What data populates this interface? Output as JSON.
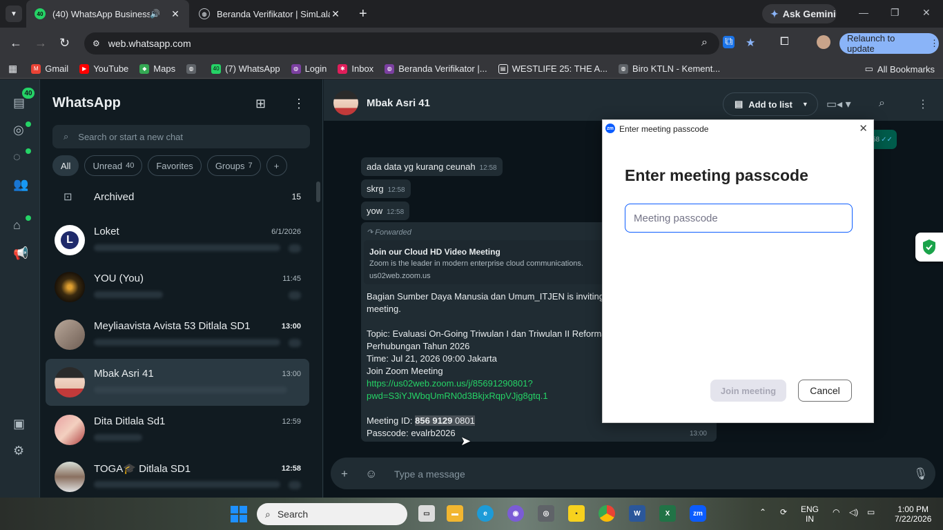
{
  "browser": {
    "tabs": [
      {
        "title": "(40) WhatsApp Business",
        "badge": "40"
      },
      {
        "title": "Beranda Verifikator | SimLala"
      }
    ],
    "gemini_label": "Ask Gemini",
    "url": "web.whatsapp.com",
    "relaunch_label": "Relaunch to update",
    "bookmarks": [
      "Gmail",
      "YouTube",
      "Maps",
      "(7) WhatsApp",
      "Login",
      "Inbox",
      "Beranda Verifikator |...",
      "WESTLIFE 25: THE A...",
      "Biro KTLN - Kement..."
    ],
    "bookmark_badge": "40",
    "all_bookmarks": "All Bookmarks",
    "accent": "#8ab4f8"
  },
  "whatsapp": {
    "rail_badge": "40",
    "title": "WhatsApp",
    "search_placeholder": "Search or start a new chat",
    "filters": [
      {
        "label": "All"
      },
      {
        "label": "Unread",
        "count": "40"
      },
      {
        "label": "Favorites"
      },
      {
        "label": "Groups",
        "count": "7"
      }
    ],
    "archived": {
      "label": "Archived",
      "count": "15"
    },
    "chats": [
      {
        "name": "Loket",
        "time": "6/1/2026"
      },
      {
        "name": "YOU (You)",
        "time": "11:45"
      },
      {
        "name": "Meyliaavista Avista 53 Ditlala SD1",
        "time": "13:00"
      },
      {
        "name": "Mbak Asri 41",
        "time": "13:00"
      },
      {
        "name": "Dita Ditlala Sd1",
        "time": "12:59"
      },
      {
        "name": "TOGA🎓 Ditlala SD1",
        "time": "12:58"
      }
    ],
    "brand_color": "#25d366"
  },
  "conversation": {
    "contact": "Mbak Asri 41",
    "add_to_list": "Add to list",
    "peek_time": "58",
    "messages": [
      {
        "text": "ada data yg kurang ceunah",
        "time": "12:58"
      },
      {
        "text": "skrg",
        "time": "12:58"
      },
      {
        "text": "yow",
        "time": "12:58"
      }
    ],
    "forwarded": {
      "label": "Forwarded",
      "preview_title": "Join our Cloud HD Video Meeting",
      "preview_desc": "Zoom is the leader in modern enterprise cloud communications.",
      "preview_domain": "us02web.zoom.us",
      "line1": "Bagian Sumber Daya Manusia dan Umum_ITJEN is inviting y",
      "line2": "meeting.",
      "topic1": "Topic: Evaluasi On-Going Triwulan I dan Triwulan II Reforma",
      "topic2": "Perhubungan Tahun 2026",
      "time_line": "Time: Jul 21, 2026 09:00 Jakarta",
      "join_label": "Join Zoom Meeting",
      "link1": "https://us02web.zoom.us/j/85691290801?",
      "link2": "pwd=S3iYJWbqUmRN0d3BkjxRqpVJjg8gtq.1",
      "meeting_id_label": "Meeting ID:",
      "meeting_id_selected": "856 9129",
      "meeting_id_rest": " 0801",
      "passcode_line": "Passcode: evalrb2026",
      "time": "13:00"
    },
    "composer_placeholder": "Type a message"
  },
  "zoom_dialog": {
    "window_title": "Enter meeting passcode",
    "logo": "zm",
    "heading": "Enter meeting passcode",
    "input_placeholder": "Meeting passcode",
    "input_value": "",
    "join_label": "Join meeting",
    "cancel_label": "Cancel",
    "accent": "#0b5cff"
  },
  "taskbar": {
    "search_label": "Search",
    "lang_line1": "ENG",
    "lang_line2": "IN",
    "clock_time": "1:00 PM",
    "clock_date": "7/22/2026"
  }
}
